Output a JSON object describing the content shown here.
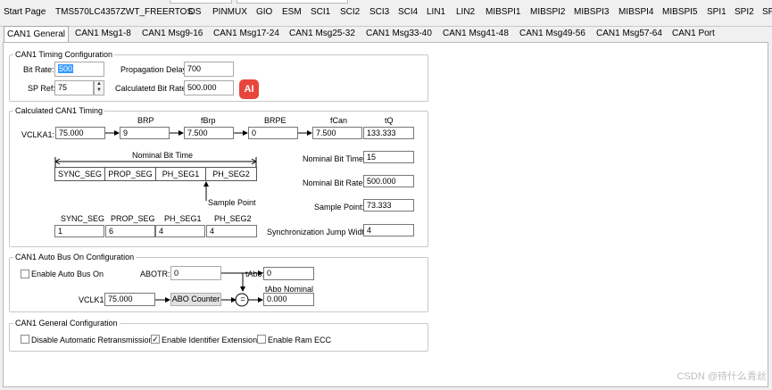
{
  "top_tabs": [
    "Start Page",
    "TMS570LC4357ZWT_FREERTOS",
    "OS",
    "PINMUX",
    "GIO",
    "ESM",
    "SCI1",
    "SCI2",
    "SCI3",
    "SCI4",
    "LIN1",
    "LIN2",
    "MIBSPI1",
    "MIBSPI2",
    "MIBSPI3",
    "MIBSPI4",
    "MIBSPI5",
    "SPI1",
    "SPI2",
    "SPI"
  ],
  "sub_tabs": [
    "CAN1 General",
    "CAN1 Msg1-8",
    "CAN1 Msg9-16",
    "CAN1 Msg17-24",
    "CAN1 Msg25-32",
    "CAN1 Msg33-40",
    "CAN1 Msg41-48",
    "CAN1 Msg49-56",
    "CAN1 Msg57-64",
    "CAN1 Port"
  ],
  "timing_config": {
    "title": "CAN1 Timing Configuration",
    "bit_rate_label": "Bit Rate:",
    "bit_rate_value": "500",
    "sp_ref_label": "SP Ref:",
    "sp_ref_value": "75",
    "prop_delay_label": "Propagation Delay:",
    "prop_delay_value": "700",
    "calc_bit_rate_label": "Calculatetd Bit Rate:",
    "calc_bit_rate_value": "500.000",
    "logo_text": "AI"
  },
  "calculated_timing": {
    "title": "Calculated CAN1 Timing",
    "vclka1_label": "VCLKA1:",
    "vclka1_value": "75.000",
    "brp_label": "BRP",
    "brp_value": "9",
    "fbrp_label": "fBrp",
    "fbrp_value": "7.500",
    "brpe_label": "BRPE",
    "brpe_value": "0",
    "fcan_label": "fCan",
    "fcan_value": "7.500",
    "tq_label": "tQ",
    "tq_value": "133.333",
    "nominal_bit_time_caption": "Nominal Bit Time",
    "segments": [
      "SYNC_SEG",
      "PROP_SEG",
      "PH_SEG1",
      "PH_SEG2"
    ],
    "sample_point_caption": "Sample Point",
    "segment_labels": [
      "SYNC_SEG",
      "PROP_SEG",
      "PH_SEG1",
      "PH_SEG2"
    ],
    "segment_values": [
      "1",
      "6",
      "4",
      "4"
    ],
    "nominal_bit_time_label": "Nominal Bit Time:",
    "nominal_bit_time_value": "15",
    "nominal_bit_rate_label": "Nominal Bit Rate:",
    "nominal_bit_rate_value": "500.000",
    "sample_point_label": "Sample Point:",
    "sample_point_value": "73.333",
    "sjw_label": "Synchronization Jump Width:",
    "sjw_value": "4"
  },
  "auto_bus_on": {
    "title": "CAN1 Auto Bus On Configuration",
    "enable_label": "Enable Auto Bus On",
    "enable_checked": false,
    "abotr_label": "ABOTR:",
    "abotr_value": "0",
    "tabo_label": "tAbo:",
    "tabo_value": "0",
    "vclk1_label": "VCLK1:",
    "vclk1_value": "75.000",
    "abo_counter_label": "ABO Counter",
    "tabo_nominal_label": "tAbo Nominal",
    "tabo_nominal_value": "0.000",
    "equals_symbol": "="
  },
  "general_config": {
    "title": "CAN1 General Configuration",
    "disable_retrans_label": "Disable Automatic Retransmission",
    "disable_retrans_checked": false,
    "enable_ident_ext_label": "Enable Identifier Extension",
    "enable_ident_ext_checked": true,
    "enable_ram_ecc_label": "Enable Ram ECC",
    "enable_ram_ecc_checked": false
  },
  "watermark": "CSDN @待什么青丝"
}
